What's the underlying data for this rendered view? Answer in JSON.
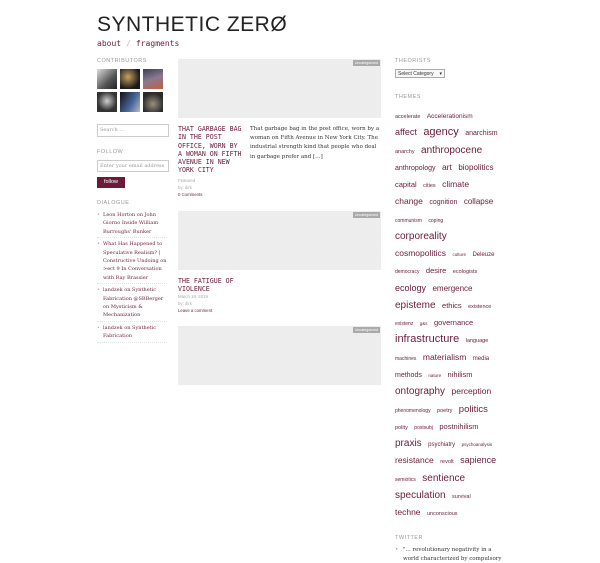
{
  "site": {
    "title": "SYNTHETIC ZERØ",
    "nav": [
      "about",
      "fragments"
    ]
  },
  "left": {
    "contributors_title": "CONTRIBUTORS",
    "search_placeholder": "Search ...",
    "follow_title": "FOLLOW",
    "email_placeholder": "Enter your email address",
    "follow_button": "follow",
    "dialogue_title": "DIALOGUE",
    "dialogue": [
      "Leon Horton on John Giorno Inside William Burroughs' Bunker",
      "What Has Happened to Speculative Realism? | Constructive Undoing on >ect 9 In Conversation with Ray Brassier",
      "landzek on Synthetic Fabrication @SBBerger on Mysticism & Mechanization",
      "landzek on Synthetic Fabrication"
    ]
  },
  "posts": [
    {
      "category": "Uncategorized",
      "title": "THAT GARBAGE BAG IN THE POST OFFICE, WORN BY A WOMAN ON FIFTH AVENUE IN NEW YORK CITY",
      "meta1": "Featured",
      "meta2": "by: dirk",
      "meta3": "0 Comments",
      "excerpt": "That garbage bag in the post office, worn by a woman on Fifth Avenue in New York City. The industrial strength kind that people who deal in garbage prefer and […]"
    },
    {
      "category": "Uncategorized",
      "title": "THE FATIGUE OF VIOLENCE",
      "meta1": "March 19, 2019",
      "meta2": "by: dirk",
      "meta3": "Leave a comment",
      "excerpt": ""
    },
    {
      "category": "Uncategorized"
    }
  ],
  "right": {
    "theorists_title": "THEORISTS",
    "select_value": "Select Category",
    "themes_title": "THEMES",
    "tags": [
      {
        "t": "accelerate",
        "s": 5.5
      },
      {
        "t": "Accelerationism",
        "s": 6.5
      },
      {
        "t": "affect",
        "s": 9
      },
      {
        "t": "agency",
        "s": 11
      },
      {
        "t": "anarchism",
        "s": 7
      },
      {
        "t": "anarchy",
        "s": 5.5
      },
      {
        "t": "anthropocene",
        "s": 10
      },
      {
        "t": "anthropology",
        "s": 7
      },
      {
        "t": "art",
        "s": 8.5
      },
      {
        "t": "biopolitics",
        "s": 8
      },
      {
        "t": "capital",
        "s": 7.5
      },
      {
        "t": "cities",
        "s": 5.5
      },
      {
        "t": "climate change",
        "s": 8.5
      },
      {
        "t": "cognition",
        "s": 7
      },
      {
        "t": "collapse",
        "s": 8
      },
      {
        "t": "communism",
        "s": 5
      },
      {
        "t": "coping",
        "s": 5
      },
      {
        "t": "corporeality",
        "s": 10
      },
      {
        "t": "cosmopolitics",
        "s": 8.5
      },
      {
        "t": "culture",
        "s": 4.5
      },
      {
        "t": "Deleuze",
        "s": 6
      },
      {
        "t": "democracy",
        "s": 5
      },
      {
        "t": "desire",
        "s": 7.5
      },
      {
        "t": "ecologists",
        "s": 5.5
      },
      {
        "t": "ecology",
        "s": 9
      },
      {
        "t": "emergence",
        "s": 8
      },
      {
        "t": "episteme",
        "s": 10
      },
      {
        "t": "ethics",
        "s": 7.5
      },
      {
        "t": "existence",
        "s": 5.5
      },
      {
        "t": "existenz",
        "s": 5
      },
      {
        "t": "g&s",
        "s": 4.5
      },
      {
        "t": "governance",
        "s": 7.5
      },
      {
        "t": "infrastructure",
        "s": 11
      },
      {
        "t": "language",
        "s": 5.5
      },
      {
        "t": "machines",
        "s": 5
      },
      {
        "t": "materialism",
        "s": 8.5
      },
      {
        "t": "media",
        "s": 6
      },
      {
        "t": "methods",
        "s": 7
      },
      {
        "t": "nature",
        "s": 4.5
      },
      {
        "t": "nihilism",
        "s": 7.5
      },
      {
        "t": "ontography",
        "s": 10
      },
      {
        "t": "perception",
        "s": 8.5
      },
      {
        "t": "phenomenology",
        "s": 5
      },
      {
        "t": "poetry",
        "s": 5.5
      },
      {
        "t": "politics",
        "s": 9.5
      },
      {
        "t": "polity",
        "s": 5.5
      },
      {
        "t": "postsubj",
        "s": 5
      },
      {
        "t": "postnihilism",
        "s": 7.5
      },
      {
        "t": "praxis",
        "s": 10
      },
      {
        "t": "psychiatry",
        "s": 6
      },
      {
        "t": "psychoanalysis",
        "s": 4.5
      },
      {
        "t": "resistance",
        "s": 8.5
      },
      {
        "t": "revolt",
        "s": 5.5
      },
      {
        "t": "sapience",
        "s": 9
      },
      {
        "t": "semiotics",
        "s": 5
      },
      {
        "t": "sentience",
        "s": 10
      },
      {
        "t": "speculation",
        "s": 10
      },
      {
        "t": "survival",
        "s": 5.5
      },
      {
        "t": "techne",
        "s": 8.5
      },
      {
        "t": "unconscious",
        "s": 5.5
      }
    ],
    "twitter_title": "TWITTER",
    "tweet": "\"... revolutionary negativity in a world characterized by compulsory"
  },
  "colors": {
    "accent": "#6a1b3a",
    "thumb": "#ededed",
    "badge": "#a9a9a9"
  }
}
